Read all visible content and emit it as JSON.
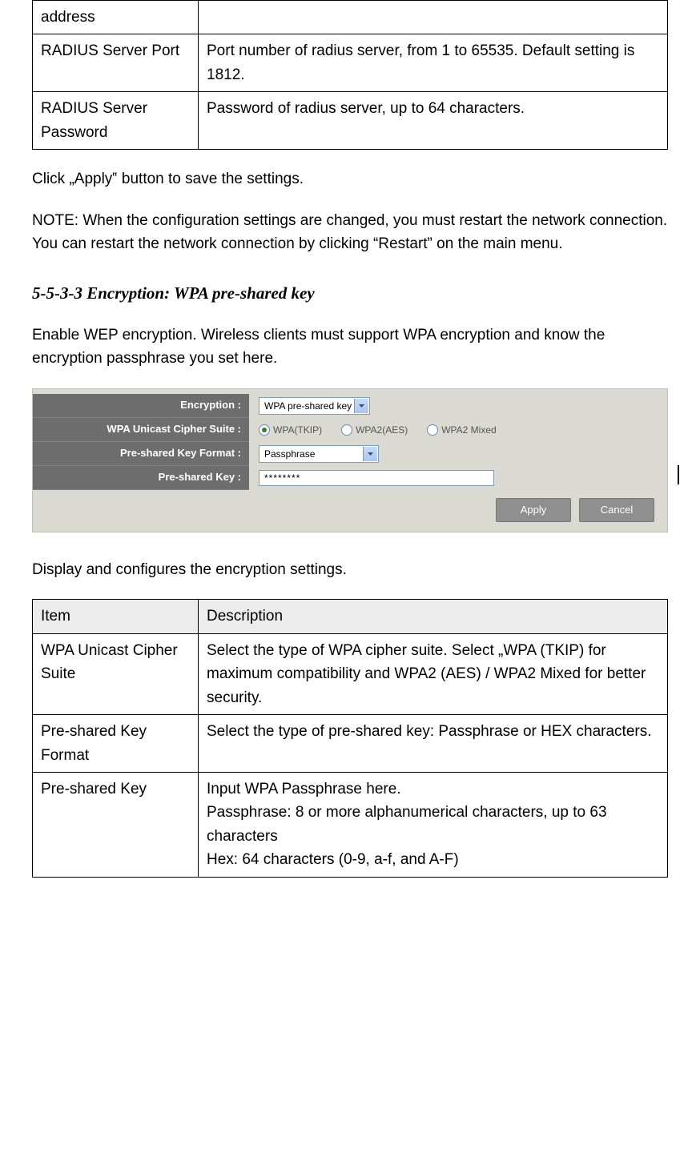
{
  "table_top": {
    "rows": [
      {
        "item": "address",
        "desc": ""
      },
      {
        "item": "RADIUS Server Port",
        "desc": "Port number of radius server, from 1 to 65535. Default setting is 1812."
      },
      {
        "item": "RADIUS Server Password",
        "desc": "Password of radius server, up to 64 characters."
      }
    ]
  },
  "para_apply": "Click „Apply‟ button to save the settings.",
  "para_note": "NOTE: When the configuration settings are changed, you must restart the network connection. You can restart the network connection by clicking “Restart” on the main menu.",
  "section_title": "5-5-3-3 Encryption: WPA pre-shared key",
  "para_intro": "Enable WEP encryption. Wireless clients must support WPA encryption and know the encryption passphrase you set here.",
  "ui": {
    "labels": {
      "encryption": "Encryption :",
      "cipher": "WPA Unicast Cipher Suite :",
      "format": "Pre-shared Key Format :",
      "key": "Pre-shared Key :"
    },
    "encryption_value": "WPA pre-shared key",
    "cipher_options": [
      {
        "label": "WPA(TKIP)",
        "selected": true
      },
      {
        "label": "WPA2(AES)",
        "selected": false
      },
      {
        "label": "WPA2 Mixed",
        "selected": false
      }
    ],
    "format_value": "Passphrase",
    "key_value": "********",
    "buttons": {
      "apply": "Apply",
      "cancel": "Cancel"
    }
  },
  "para_display": "Display and configures the encryption settings.",
  "table_bottom": {
    "header": {
      "item": "Item",
      "desc": "Description"
    },
    "rows": [
      {
        "item": "WPA Unicast Cipher Suite",
        "desc": "Select the type of WPA cipher suite. Select „WPA (TKIP) for maximum compatibility and WPA2 (AES) / WPA2 Mixed for better security."
      },
      {
        "item": "Pre-shared Key Format",
        "desc": "Select the type of pre-shared key: Passphrase or HEX characters."
      },
      {
        "item": "Pre-shared Key",
        "desc": "Input WPA Passphrase here.\nPassphrase: 8 or more alphanumerical characters, up to 63 characters\nHex: 64 characters (0-9, a-f, and A-F)"
      }
    ]
  }
}
